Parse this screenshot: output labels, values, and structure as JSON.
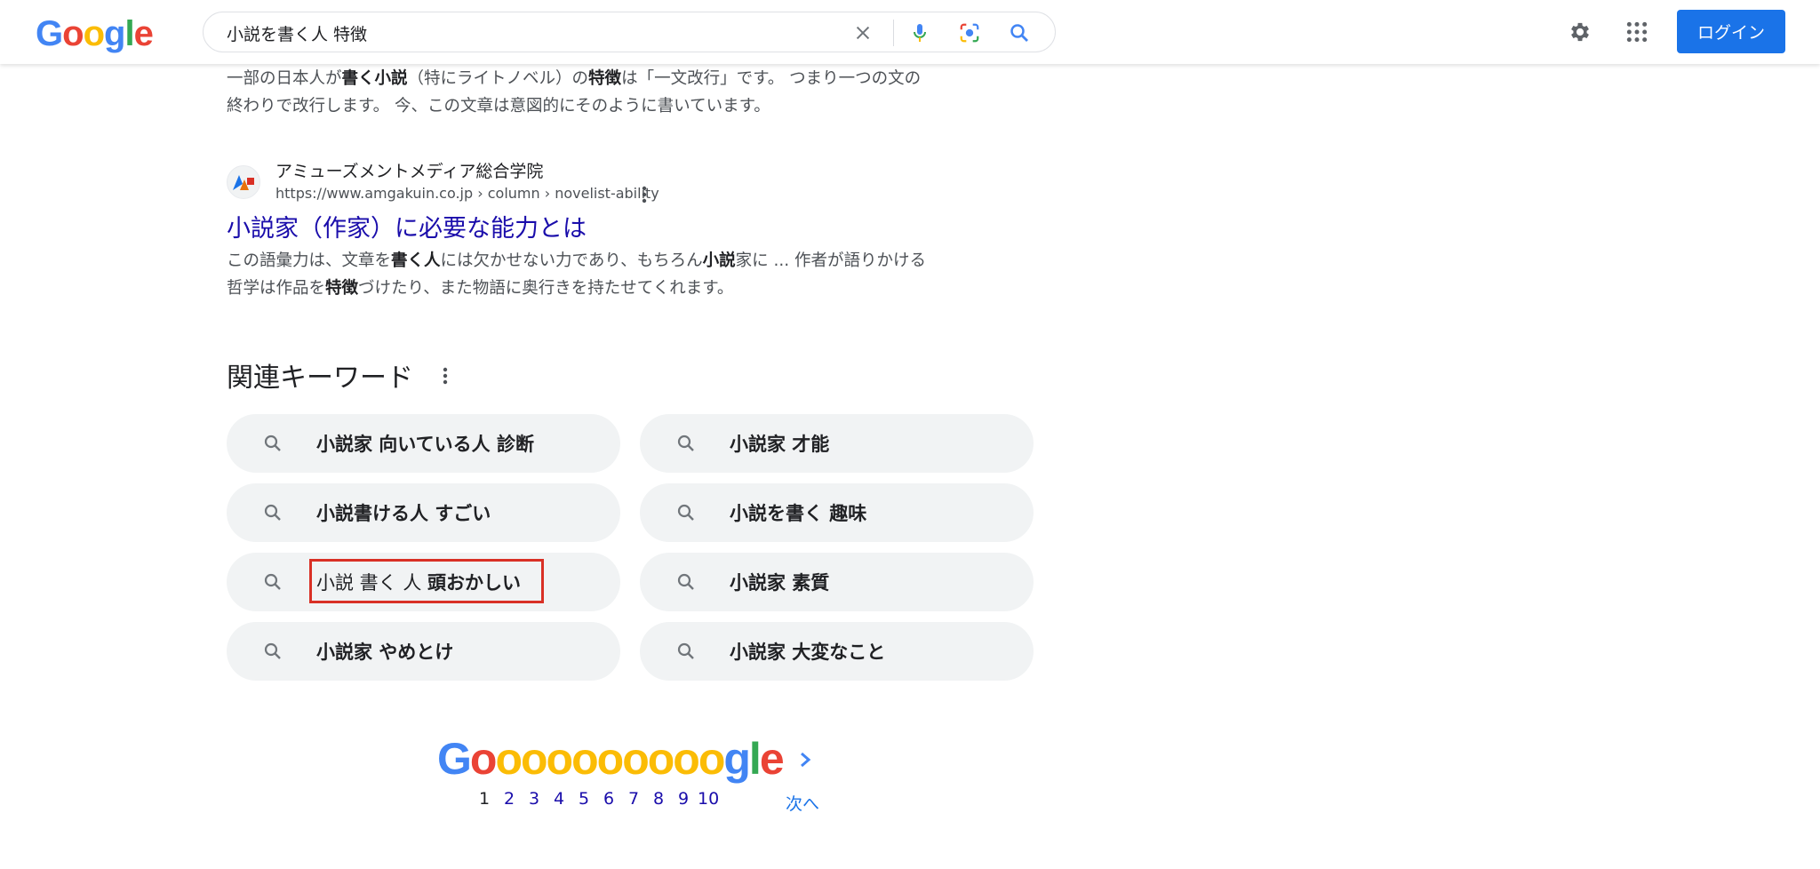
{
  "header": {
    "logo_letters": [
      {
        "ch": "G",
        "color": "#4285F4"
      },
      {
        "ch": "o",
        "color": "#EA4335"
      },
      {
        "ch": "o",
        "color": "#FBBC05"
      },
      {
        "ch": "g",
        "color": "#4285F4"
      },
      {
        "ch": "l",
        "color": "#34A853"
      },
      {
        "ch": "e",
        "color": "#EA4335"
      }
    ],
    "search_value": "小説を書く人 特徴",
    "icons": [
      "clear-icon",
      "microphone-icon",
      "camera-lens-icon",
      "search-icon",
      "gear-icon",
      "apps-grid-icon"
    ],
    "login_label": "ログイン"
  },
  "top_snippet": {
    "line1_parts": [
      {
        "t": "一部の日本人が",
        "b": false
      },
      {
        "t": "書く小説",
        "b": true
      },
      {
        "t": "（特にライトノベル）の",
        "b": false
      },
      {
        "t": "特徴",
        "b": true
      },
      {
        "t": "は「一文改行」です。 つまり一つの文の",
        "b": false
      }
    ],
    "line2": "終わりで改行します。 今、この文章は意図的にそのように書いています。"
  },
  "result": {
    "site_name": "アミューズメントメディア総合学院",
    "url": "https://www.amgakuin.co.jp › column › novelist-ability",
    "title": "小説家（作家）に必要な能力とは",
    "snippet_line1_parts": [
      {
        "t": "この語彙力は、文章を",
        "b": false
      },
      {
        "t": "書く人",
        "b": true
      },
      {
        "t": "には欠かせない力であり、もちろん",
        "b": false
      },
      {
        "t": "小説",
        "b": true
      },
      {
        "t": "家に ... 作者が語りかける",
        "b": false
      }
    ],
    "snippet_line2_parts": [
      {
        "t": "哲学は作品を",
        "b": false
      },
      {
        "t": "特徴",
        "b": true
      },
      {
        "t": "づけたり、また物語に奥行きを持たせてくれます。",
        "b": false
      }
    ]
  },
  "related": {
    "heading": "関連キーワード",
    "chips": [
      {
        "label": "小説家 向いている人 診断"
      },
      {
        "label": "小説家 才能"
      },
      {
        "label": "小説書ける人 すごい"
      },
      {
        "label": "小説を書く 趣味"
      },
      {
        "plain": "小説 書く 人 ",
        "bold": "頭おかしい",
        "highlighted": true
      },
      {
        "label": "小説家 素質"
      },
      {
        "label": "小説家 やめとけ"
      },
      {
        "label": "小説家 大変なこと"
      }
    ]
  },
  "pagination": {
    "logo_letters": [
      {
        "ch": "G",
        "color": "#4285F4"
      },
      {
        "ch": "o",
        "color": "#EA4335"
      },
      {
        "ch": "o",
        "color": "#FBBC05"
      },
      {
        "ch": "o",
        "color": "#FBBC05"
      },
      {
        "ch": "o",
        "color": "#FBBC05"
      },
      {
        "ch": "o",
        "color": "#FBBC05"
      },
      {
        "ch": "o",
        "color": "#FBBC05"
      },
      {
        "ch": "o",
        "color": "#FBBC05"
      },
      {
        "ch": "o",
        "color": "#FBBC05"
      },
      {
        "ch": "o",
        "color": "#FBBC05"
      },
      {
        "ch": "o",
        "color": "#FBBC05"
      },
      {
        "ch": "g",
        "color": "#4285F4"
      },
      {
        "ch": "l",
        "color": "#34A853"
      },
      {
        "ch": "e",
        "color": "#EA4335"
      }
    ],
    "pages": [
      "1",
      "2",
      "3",
      "4",
      "5",
      "6",
      "7",
      "8",
      "9",
      "10"
    ],
    "current_page": "1",
    "next_label": "次へ"
  }
}
